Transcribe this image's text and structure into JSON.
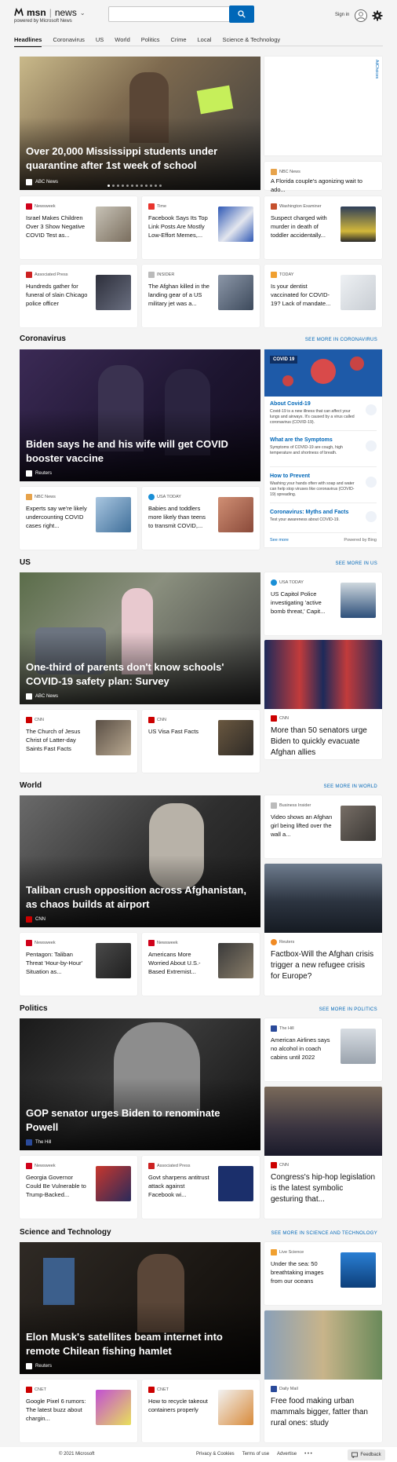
{
  "header": {
    "logo_msn": "msn",
    "logo_sep": "|",
    "logo_news": "news",
    "powered_by": "powered by Microsoft News",
    "search_placeholder": "",
    "signin": "Sign in"
  },
  "nav": [
    "Headlines",
    "Coronavirus",
    "US",
    "World",
    "Politics",
    "Crime",
    "Local",
    "Science & Technology"
  ],
  "ad_choices": "AdChoices",
  "top": {
    "hero": {
      "title": "Over 20,000 Mississippi students under quarantine after 1st week of school",
      "source": "ABC News"
    },
    "side": {
      "source": "NBC News",
      "title": "A Florida couple's agonizing wait to ado..."
    },
    "row1": [
      {
        "source": "Newsweek",
        "title": "Israel Makes Children Over 3 Show Negative COVID Test as..."
      },
      {
        "source": "Time",
        "title": "Facebook Says Its Top Link Posts Are Mostly Low-Effort Memes,..."
      },
      {
        "source": "Washington Examiner",
        "title": "Suspect charged with murder in death of toddler accidentally..."
      }
    ],
    "row2": [
      {
        "source": "Associated Press",
        "title": "Hundreds gather for funeral of slain Chicago police officer"
      },
      {
        "source": "INSIDER",
        "title": "The Afghan killed in the landing gear of a US military jet was a..."
      },
      {
        "source": "TODAY",
        "title": "Is your dentist vaccinated for COVID-19? Lack of mandate..."
      }
    ]
  },
  "coronavirus": {
    "title": "Coronavirus",
    "see_more": "SEE MORE IN CORONAVIRUS",
    "hero": {
      "title": "Biden says he and his wife will get COVID booster vaccine",
      "source": "Reuters"
    },
    "cards": [
      {
        "source": "NBC News",
        "title": "Experts say we're likely undercounting COVID cases right..."
      },
      {
        "source": "USA TODAY",
        "title": "Babies and toddlers more likely than teens to transmit COVID,..."
      }
    ],
    "widget": {
      "tag": "COVID 19",
      "items": [
        {
          "h": "About Covid-19",
          "d": "Covid-19 is a new illness that can affect your lungs and airways. It's caused by a virus called coronavirus (COVID-19)."
        },
        {
          "h": "What are the Symptoms",
          "d": "Symptoms of COVID-19 are cough, high temperature and shortness of breath."
        },
        {
          "h": "How to Prevent",
          "d": "Washing your hands often with soap and water can help stop viruses like coronavirus (COVID-19) spreading."
        },
        {
          "h": "Coronavirus: Myths and Facts",
          "d": "Test your awareness about COVID-19."
        }
      ],
      "see_more": "See more",
      "powered": "Powered by Bing"
    }
  },
  "us": {
    "title": "US",
    "see_more": "SEE MORE IN US",
    "hero": {
      "title": "One-third of parents don't know schools' COVID-19 safety plan: Survey",
      "source": "ABC News"
    },
    "side": {
      "source": "USA TODAY",
      "title": "US Capitol Police investigating 'active bomb threat,' Capit..."
    },
    "cards": [
      {
        "source": "CNN",
        "title": "The Church of Jesus Christ of Latter-day Saints Fast Facts"
      },
      {
        "source": "CNN",
        "title": "US Visa Fast Facts"
      }
    ],
    "imgcard": {
      "source": "CNN",
      "title": "More than 50 senators urge Biden to quickly evacuate Afghan allies"
    }
  },
  "world": {
    "title": "World",
    "see_more": "SEE MORE IN WORLD",
    "hero": {
      "title": "Taliban crush opposition across Afghanistan, as chaos builds at airport",
      "source": "CNN"
    },
    "side": {
      "source": "Business Insider",
      "title": "Video shows an Afghan girl being lifted over the wall a..."
    },
    "cards": [
      {
        "source": "Newsweek",
        "title": "Pentagon: Taliban Threat 'Hour-by-Hour' Situation as..."
      },
      {
        "source": "Newsweek",
        "title": "Americans More Worried About U.S.-Based Extremist..."
      }
    ],
    "imgcard": {
      "source": "Reuters",
      "title": "Factbox-Will the Afghan crisis trigger a new refugee crisis for Europe?"
    }
  },
  "politics": {
    "title": "Politics",
    "see_more": "SEE MORE IN POLITICS",
    "hero": {
      "title": "GOP senator urges Biden to renominate Powell",
      "source": "The Hill"
    },
    "side": {
      "source": "The Hill",
      "title": "American Airlines says no alcohol in coach cabins until 2022"
    },
    "cards": [
      {
        "source": "Newsweek",
        "title": "Georgia Governor Could Be Vulnerable to Trump-Backed..."
      },
      {
        "source": "Associated Press",
        "title": "Govt sharpens antitrust attack against Facebook wi..."
      }
    ],
    "imgcard": {
      "source": "CNN",
      "title": "Congress's hip-hop legislation is the latest symbolic gesturing that..."
    }
  },
  "scitech": {
    "title": "Science and Technology",
    "see_more": "SEE MORE IN SCIENCE AND TECHNOLOGY",
    "hero": {
      "title": "Elon Musk's satellites beam internet into remote Chilean fishing hamlet",
      "source": "Reuters"
    },
    "side": {
      "source": "Live Science",
      "title": "Under the sea: 50 breathtaking images from our oceans"
    },
    "cards": [
      {
        "source": "CNET",
        "title": "Google Pixel 6 rumors: The latest buzz about chargin..."
      },
      {
        "source": "CNET",
        "title": "How to recycle takeout containers properly"
      }
    ],
    "imgcard": {
      "source": "Daily Mail",
      "title": "Free food making urban mammals bigger, fatter than rural ones: study"
    }
  },
  "footer": {
    "copyright": "© 2021 Microsoft",
    "links": [
      "Privacy & Cookies",
      "Terms of use",
      "Advertise",
      "• • •"
    ],
    "feedback": "Feedback"
  }
}
